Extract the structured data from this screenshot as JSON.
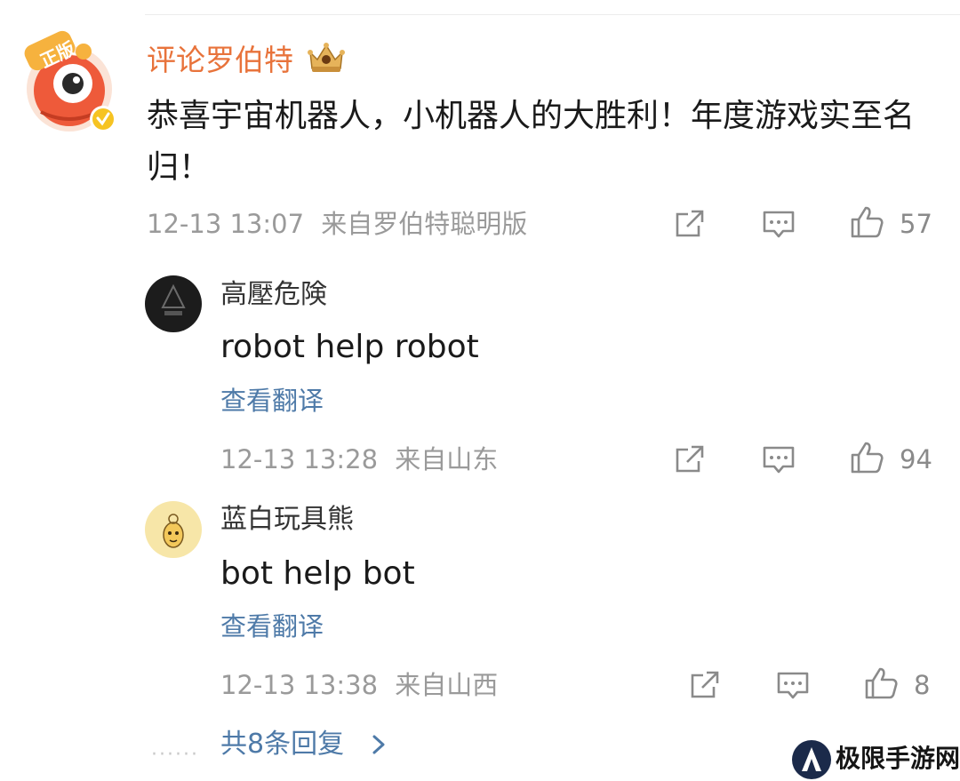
{
  "main_comment": {
    "author": "评论罗伯特",
    "text": "恭喜宇宙机器人，小机器人的大胜利！年度游戏实至名归！",
    "time": "12-13 13:07",
    "source": "来自罗伯特聪明版",
    "likes": "57"
  },
  "replies": [
    {
      "author": "高壓危険",
      "text": "robot help robot",
      "translate": "查看翻译",
      "time": "12-13 13:28",
      "source": "来自山东",
      "likes": "94"
    },
    {
      "author": "蓝白玩具熊",
      "text": "bot help bot",
      "translate": "查看翻译",
      "time": "12-13 13:38",
      "source": "来自山西",
      "likes": "8"
    }
  ],
  "more_replies": "共8条回复",
  "watermark": "极限手游网",
  "icons": [
    "share-icon",
    "comment-icon",
    "like-icon",
    "chevron-right-icon",
    "crown-icon"
  ],
  "colors": {
    "author_accent": "#e8733b",
    "link": "#4e7aa8",
    "meta": "#9a9a9a"
  }
}
